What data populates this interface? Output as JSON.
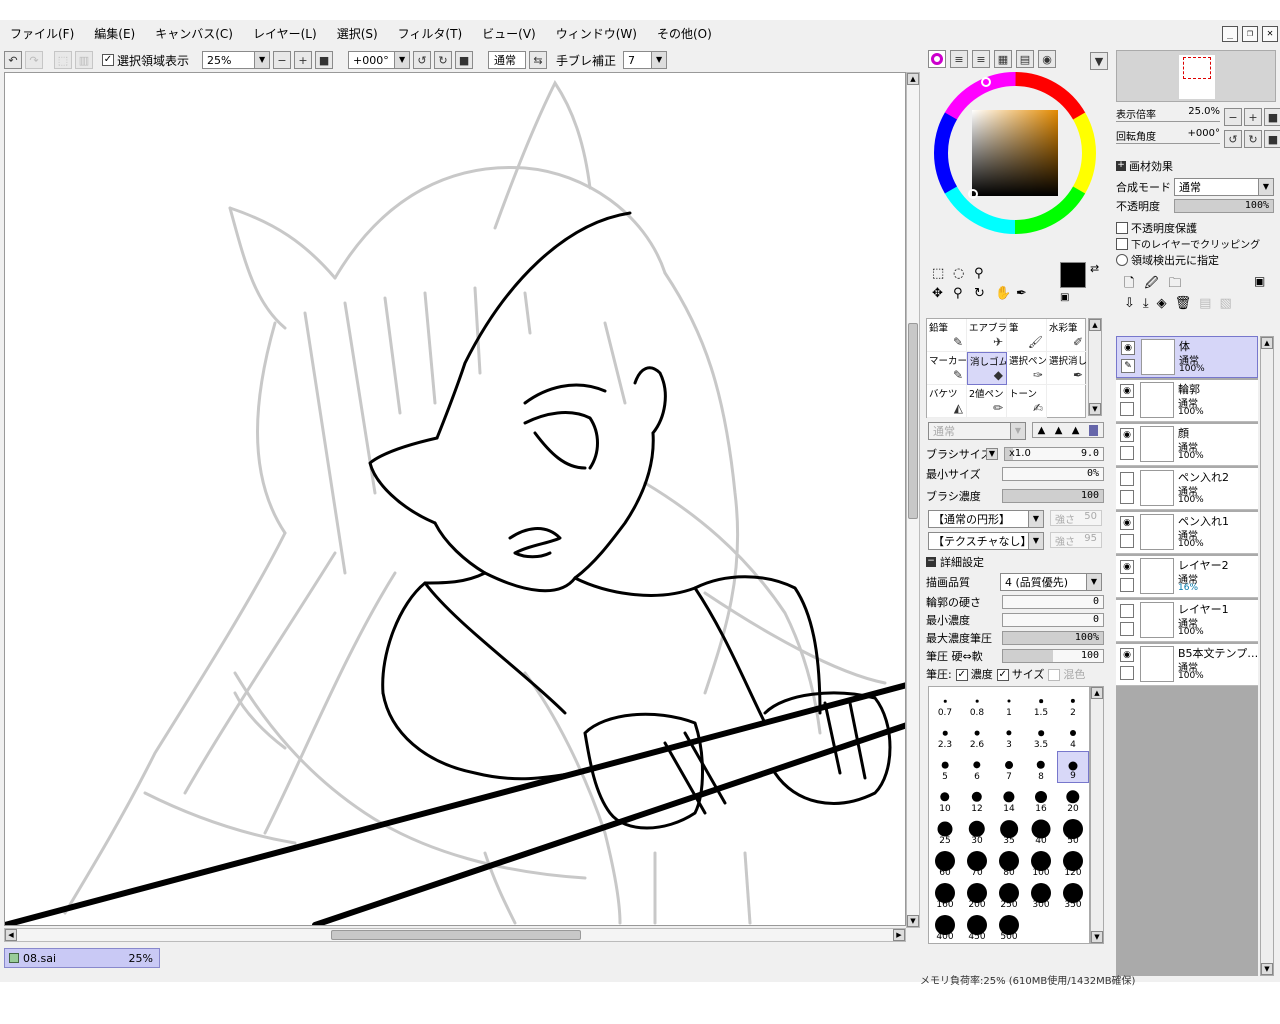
{
  "menu": [
    "ファイル(F)",
    "編集(E)",
    "キャンバス(C)",
    "レイヤー(L)",
    "選択(S)",
    "フィルタ(T)",
    "ビュー(V)",
    "ウィンドウ(W)",
    "その他(O)"
  ],
  "window_controls": {
    "minimize": "_",
    "restore": "❐",
    "close": "✕"
  },
  "toolbar": {
    "show_selection_label": "選択領域表示",
    "zoom_value": "25%",
    "rotation_value": "+000°",
    "blend_normal": "通常",
    "stabilizer_label": "手ブレ補正",
    "stabilizer_value": "7"
  },
  "file_tab": {
    "name": "08.sai",
    "zoom": "25%"
  },
  "navigator": {
    "zoom_label": "表示倍率",
    "zoom_value": "25.0%",
    "rotation_label": "回転角度",
    "rotation_value": "+000°"
  },
  "layer_props": {
    "paper_effect": "画材効果",
    "blend_label": "合成モード",
    "blend_value": "通常",
    "opacity_label": "不透明度",
    "opacity_value": "100%",
    "opacity_fraction": 1.0,
    "preserve_opacity": "不透明度保護",
    "clip_lower": "下のレイヤーでクリッピング",
    "selection_source": "領域検出元に指定"
  },
  "layers": [
    {
      "name": "体",
      "mode": "通常",
      "opacity": "100%",
      "selected": true,
      "visible": true
    },
    {
      "name": "輪郭",
      "mode": "通常",
      "opacity": "100%",
      "selected": false,
      "visible": true
    },
    {
      "name": "顔",
      "mode": "通常",
      "opacity": "100%",
      "selected": false,
      "visible": true
    },
    {
      "name": "ペン入れ2",
      "mode": "通常",
      "opacity": "100%",
      "selected": false,
      "visible": false
    },
    {
      "name": "ペン入れ1",
      "mode": "通常",
      "opacity": "100%",
      "selected": false,
      "visible": true
    },
    {
      "name": "レイヤー2",
      "mode": "通常",
      "opacity": "16%",
      "selected": false,
      "visible": true
    },
    {
      "name": "レイヤー1",
      "mode": "通常",
      "opacity": "100%",
      "selected": false,
      "visible": false
    },
    {
      "name": "B5本文テンプ…",
      "mode": "通常",
      "opacity": "100%",
      "selected": false,
      "visible": true
    }
  ],
  "tools": [
    {
      "name": "鉛筆",
      "icon": "pencil-icon"
    },
    {
      "name": "エアブラシ",
      "icon": "airbrush-icon"
    },
    {
      "name": "筆",
      "icon": "brush-icon"
    },
    {
      "name": "水彩筆",
      "icon": "watercolor-icon"
    },
    {
      "name": "マーカー",
      "icon": "marker-icon"
    },
    {
      "name": "消しゴム",
      "icon": "eraser-icon",
      "selected": true
    },
    {
      "name": "選択ペン",
      "icon": "select-pen-icon"
    },
    {
      "name": "選択消し",
      "icon": "select-erase-icon"
    },
    {
      "name": "バケツ",
      "icon": "bucket-icon"
    },
    {
      "name": "2値ペン",
      "icon": "binary-pen-icon"
    },
    {
      "name": "トーン",
      "icon": "tone-icon"
    }
  ],
  "brush": {
    "blend_value": "通常",
    "size_label": "ブラシサイズ",
    "size_mult": "x1.0",
    "size_value": "9.0",
    "min_size_label": "最小サイズ",
    "min_size_value": "0%",
    "density_label": "ブラシ濃度",
    "density_value": "100",
    "shape_value": "【通常の円形】",
    "shape_strength": "強さ",
    "shape_strength_value": "50",
    "texture_value": "【テクスチャなし】",
    "texture_strength": "強さ",
    "texture_strength_value": "95",
    "advanced_label": "詳細設定",
    "quality_label": "描画品質",
    "quality_value": "4 (品質優先)",
    "edge_hardness_label": "輪郭の硬さ",
    "edge_hardness_value": "0",
    "min_density_label": "最小濃度",
    "min_density_value": "0",
    "max_pressure_label": "最大濃度筆圧",
    "max_pressure_value": "100%",
    "pressure_label": "筆圧 硬⇔軟",
    "pressure_value": "100",
    "pressure_flags_label": "筆圧:",
    "flag_density": "濃度",
    "flag_size": "サイズ",
    "flag_blend": "混色"
  },
  "brush_sizes": [
    "0.7",
    "0.8",
    "1",
    "1.5",
    "2",
    "2.3",
    "2.6",
    "3",
    "3.5",
    "4",
    "5",
    "6",
    "7",
    "8",
    "9",
    "10",
    "12",
    "14",
    "16",
    "20",
    "25",
    "30",
    "35",
    "40",
    "50",
    "60",
    "70",
    "80",
    "100",
    "120",
    "160",
    "200",
    "250",
    "300",
    "350",
    "400",
    "450",
    "500"
  ],
  "selected_brush_size": "9",
  "status": "メモリ負荷率:25% (610MB使用/1432MB確保)",
  "colors": {
    "accent_selection": "#d6d6f8",
    "primary_color": "#000000",
    "secondary_color": "#ffffff"
  }
}
